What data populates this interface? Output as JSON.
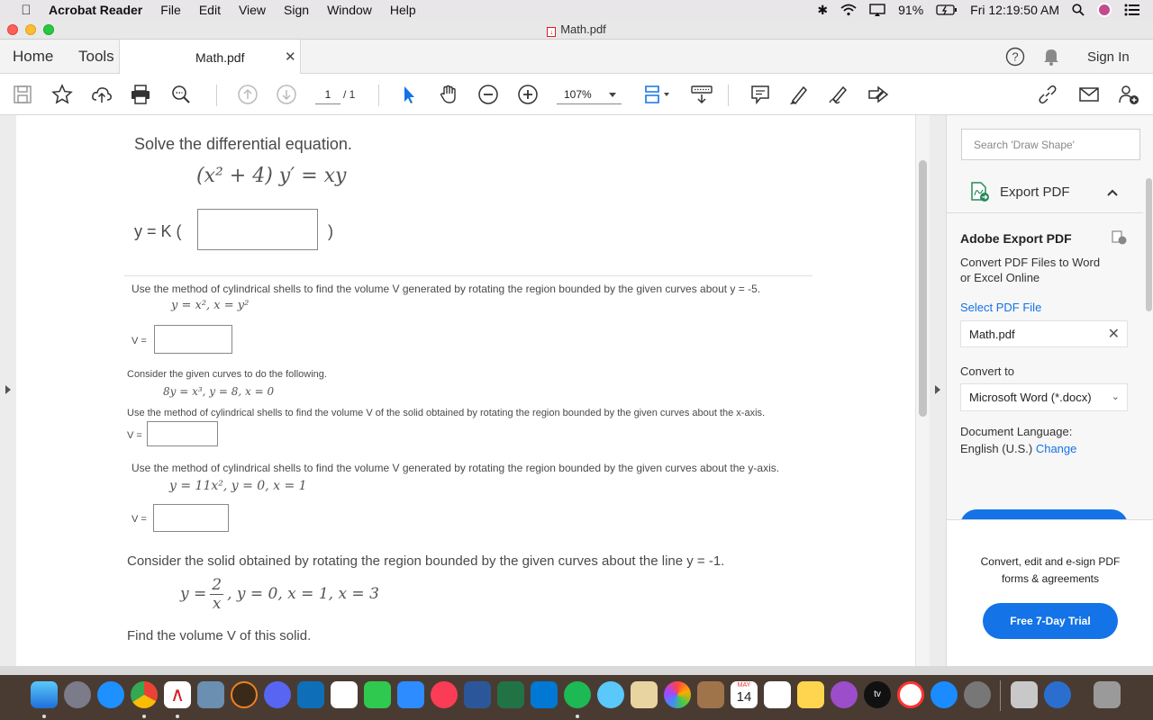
{
  "menubar": {
    "app_name": "Acrobat Reader",
    "menus": [
      "File",
      "Edit",
      "View",
      "Sign",
      "Window",
      "Help"
    ],
    "battery": "91%",
    "clock": "Fri 12:19:50 AM"
  },
  "window": {
    "title": "Math.pdf"
  },
  "tabs": {
    "home": "Home",
    "tools": "Tools",
    "document": "Math.pdf",
    "sign_in": "Sign In"
  },
  "toolbar": {
    "page_current": "1",
    "page_total": "/ 1",
    "zoom": "107%"
  },
  "document": {
    "q1": {
      "prompt": "Solve the differential equation.",
      "equation": "(x² + 4) y′ = xy",
      "answer_prefix": "y = K (",
      "answer_suffix": ")"
    },
    "q2": {
      "prompt": "Use the method of cylindrical shells to find the volume V generated by rotating the region bounded by the given curves about y = -5.",
      "curves": "y = x², x = y²",
      "answer_label": "V ="
    },
    "q3": {
      "intro": "Consider the given curves to do the following.",
      "curves": "8y = x³, y = 8, x = 0",
      "prompt": "Use the method of cylindrical shells to find the volume V of the solid obtained by rotating the region bounded by the given curves about the x-axis.",
      "answer_label": "V ="
    },
    "q4": {
      "prompt": "Use the method of cylindrical shells to find the volume V generated by rotating the region bounded by the given curves about the y-axis.",
      "curves": "y = 11x², y = 0, x = 1",
      "answer_label": "V ="
    },
    "q5": {
      "prompt": "Consider the solid obtained by rotating the region bounded by the given curves about the line y = -1.",
      "curves_lhs": "y =",
      "frac_num": "2",
      "frac_den": "x",
      "curves_rest": ",  y = 0,  x = 1,  x = 3",
      "find": "Find the volume V of this solid."
    }
  },
  "panel": {
    "search_placeholder": "Search 'Draw Shape'",
    "export_header": "Export PDF",
    "title": "Adobe Export PDF",
    "description_line1": "Convert PDF Files to Word",
    "description_line2": "or Excel Online",
    "select_file": "Select PDF File",
    "file_name": "Math.pdf",
    "convert_to_label": "Convert to",
    "convert_to_value": "Microsoft Word (*.docx)",
    "language_label": "Document Language:",
    "language_value": "English (U.S.)",
    "language_change": "Change",
    "promo_line1": "Convert, edit and e-sign PDF",
    "promo_line2": "forms & agreements",
    "trial_button": "Free 7-Day Trial"
  },
  "dock": {
    "calendar_month": "MAY",
    "calendar_day": "14"
  }
}
